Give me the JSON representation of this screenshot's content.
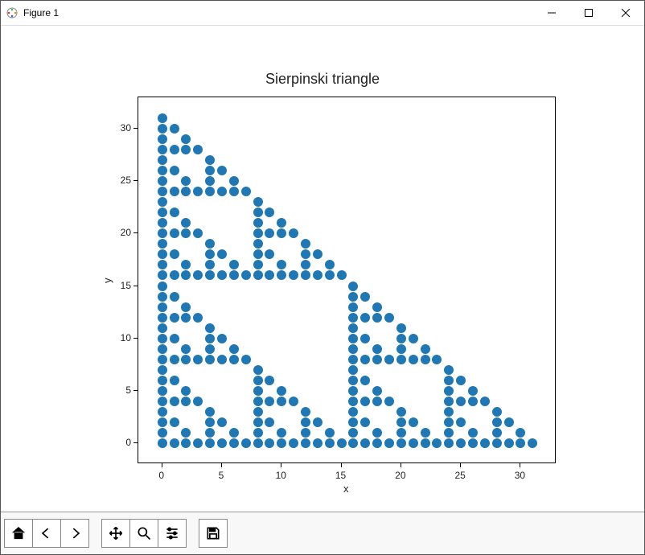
{
  "window": {
    "title": "Figure 1"
  },
  "chart_data": {
    "type": "scatter",
    "title": "Sierpinski triangle",
    "xlabel": "x",
    "ylabel": "y",
    "xlim": [
      -2,
      33
    ],
    "ylim": [
      -2,
      33
    ],
    "xticks": [
      0,
      5,
      10,
      15,
      20,
      25,
      30
    ],
    "yticks": [
      0,
      5,
      10,
      15,
      20,
      25,
      30
    ],
    "description": "points (x,y) for 0<=x<=31,0<=y<=31 where Pascal's triangle entry C(x+y,x) is odd, i.e. (x & y)==0",
    "series": [
      {
        "name": "points",
        "color": "#1f77b4",
        "marker": "o",
        "points": [
          [
            0,
            0
          ],
          [
            1,
            0
          ],
          [
            2,
            0
          ],
          [
            3,
            0
          ],
          [
            4,
            0
          ],
          [
            5,
            0
          ],
          [
            6,
            0
          ],
          [
            7,
            0
          ],
          [
            8,
            0
          ],
          [
            9,
            0
          ],
          [
            10,
            0
          ],
          [
            11,
            0
          ],
          [
            12,
            0
          ],
          [
            13,
            0
          ],
          [
            14,
            0
          ],
          [
            15,
            0
          ],
          [
            16,
            0
          ],
          [
            17,
            0
          ],
          [
            18,
            0
          ],
          [
            19,
            0
          ],
          [
            20,
            0
          ],
          [
            21,
            0
          ],
          [
            22,
            0
          ],
          [
            23,
            0
          ],
          [
            24,
            0
          ],
          [
            25,
            0
          ],
          [
            26,
            0
          ],
          [
            27,
            0
          ],
          [
            28,
            0
          ],
          [
            29,
            0
          ],
          [
            30,
            0
          ],
          [
            31,
            0
          ],
          [
            0,
            1
          ],
          [
            2,
            1
          ],
          [
            4,
            1
          ],
          [
            6,
            1
          ],
          [
            8,
            1
          ],
          [
            10,
            1
          ],
          [
            12,
            1
          ],
          [
            14,
            1
          ],
          [
            16,
            1
          ],
          [
            18,
            1
          ],
          [
            20,
            1
          ],
          [
            22,
            1
          ],
          [
            24,
            1
          ],
          [
            26,
            1
          ],
          [
            28,
            1
          ],
          [
            30,
            1
          ],
          [
            0,
            2
          ],
          [
            1,
            2
          ],
          [
            4,
            2
          ],
          [
            5,
            2
          ],
          [
            8,
            2
          ],
          [
            9,
            2
          ],
          [
            12,
            2
          ],
          [
            13,
            2
          ],
          [
            16,
            2
          ],
          [
            17,
            2
          ],
          [
            20,
            2
          ],
          [
            21,
            2
          ],
          [
            24,
            2
          ],
          [
            25,
            2
          ],
          [
            28,
            2
          ],
          [
            29,
            2
          ],
          [
            0,
            3
          ],
          [
            4,
            3
          ],
          [
            8,
            3
          ],
          [
            12,
            3
          ],
          [
            16,
            3
          ],
          [
            20,
            3
          ],
          [
            24,
            3
          ],
          [
            28,
            3
          ],
          [
            0,
            4
          ],
          [
            1,
            4
          ],
          [
            2,
            4
          ],
          [
            3,
            4
          ],
          [
            8,
            4
          ],
          [
            9,
            4
          ],
          [
            10,
            4
          ],
          [
            11,
            4
          ],
          [
            16,
            4
          ],
          [
            17,
            4
          ],
          [
            18,
            4
          ],
          [
            19,
            4
          ],
          [
            24,
            4
          ],
          [
            25,
            4
          ],
          [
            26,
            4
          ],
          [
            27,
            4
          ],
          [
            0,
            5
          ],
          [
            2,
            5
          ],
          [
            8,
            5
          ],
          [
            10,
            5
          ],
          [
            16,
            5
          ],
          [
            18,
            5
          ],
          [
            24,
            5
          ],
          [
            26,
            5
          ],
          [
            0,
            6
          ],
          [
            1,
            6
          ],
          [
            8,
            6
          ],
          [
            9,
            6
          ],
          [
            16,
            6
          ],
          [
            17,
            6
          ],
          [
            24,
            6
          ],
          [
            25,
            6
          ],
          [
            0,
            7
          ],
          [
            8,
            7
          ],
          [
            16,
            7
          ],
          [
            24,
            7
          ],
          [
            0,
            8
          ],
          [
            1,
            8
          ],
          [
            2,
            8
          ],
          [
            3,
            8
          ],
          [
            4,
            8
          ],
          [
            5,
            8
          ],
          [
            6,
            8
          ],
          [
            7,
            8
          ],
          [
            16,
            8
          ],
          [
            17,
            8
          ],
          [
            18,
            8
          ],
          [
            19,
            8
          ],
          [
            20,
            8
          ],
          [
            21,
            8
          ],
          [
            22,
            8
          ],
          [
            23,
            8
          ],
          [
            0,
            9
          ],
          [
            2,
            9
          ],
          [
            4,
            9
          ],
          [
            6,
            9
          ],
          [
            16,
            9
          ],
          [
            18,
            9
          ],
          [
            20,
            9
          ],
          [
            22,
            9
          ],
          [
            0,
            10
          ],
          [
            1,
            10
          ],
          [
            4,
            10
          ],
          [
            5,
            10
          ],
          [
            16,
            10
          ],
          [
            17,
            10
          ],
          [
            20,
            10
          ],
          [
            21,
            10
          ],
          [
            0,
            11
          ],
          [
            4,
            11
          ],
          [
            16,
            11
          ],
          [
            20,
            11
          ],
          [
            0,
            12
          ],
          [
            1,
            12
          ],
          [
            2,
            12
          ],
          [
            3,
            12
          ],
          [
            16,
            12
          ],
          [
            17,
            12
          ],
          [
            18,
            12
          ],
          [
            19,
            12
          ],
          [
            0,
            13
          ],
          [
            2,
            13
          ],
          [
            16,
            13
          ],
          [
            18,
            13
          ],
          [
            0,
            14
          ],
          [
            1,
            14
          ],
          [
            16,
            14
          ],
          [
            17,
            14
          ],
          [
            0,
            15
          ],
          [
            16,
            15
          ],
          [
            0,
            16
          ],
          [
            1,
            16
          ],
          [
            2,
            16
          ],
          [
            3,
            16
          ],
          [
            4,
            16
          ],
          [
            5,
            16
          ],
          [
            6,
            16
          ],
          [
            7,
            16
          ],
          [
            8,
            16
          ],
          [
            9,
            16
          ],
          [
            10,
            16
          ],
          [
            11,
            16
          ],
          [
            12,
            16
          ],
          [
            13,
            16
          ],
          [
            14,
            16
          ],
          [
            15,
            16
          ],
          [
            0,
            17
          ],
          [
            2,
            17
          ],
          [
            4,
            17
          ],
          [
            6,
            17
          ],
          [
            8,
            17
          ],
          [
            10,
            17
          ],
          [
            12,
            17
          ],
          [
            14,
            17
          ],
          [
            0,
            18
          ],
          [
            1,
            18
          ],
          [
            4,
            18
          ],
          [
            5,
            18
          ],
          [
            8,
            18
          ],
          [
            9,
            18
          ],
          [
            12,
            18
          ],
          [
            13,
            18
          ],
          [
            0,
            19
          ],
          [
            4,
            19
          ],
          [
            8,
            19
          ],
          [
            12,
            19
          ],
          [
            0,
            20
          ],
          [
            1,
            20
          ],
          [
            2,
            20
          ],
          [
            3,
            20
          ],
          [
            8,
            20
          ],
          [
            9,
            20
          ],
          [
            10,
            20
          ],
          [
            11,
            20
          ],
          [
            0,
            21
          ],
          [
            2,
            21
          ],
          [
            8,
            21
          ],
          [
            10,
            21
          ],
          [
            0,
            22
          ],
          [
            1,
            22
          ],
          [
            8,
            22
          ],
          [
            9,
            22
          ],
          [
            0,
            23
          ],
          [
            8,
            23
          ],
          [
            0,
            24
          ],
          [
            1,
            24
          ],
          [
            2,
            24
          ],
          [
            3,
            24
          ],
          [
            4,
            24
          ],
          [
            5,
            24
          ],
          [
            6,
            24
          ],
          [
            7,
            24
          ],
          [
            0,
            25
          ],
          [
            2,
            25
          ],
          [
            4,
            25
          ],
          [
            6,
            25
          ],
          [
            0,
            26
          ],
          [
            1,
            26
          ],
          [
            4,
            26
          ],
          [
            5,
            26
          ],
          [
            0,
            27
          ],
          [
            4,
            27
          ],
          [
            0,
            28
          ],
          [
            1,
            28
          ],
          [
            2,
            28
          ],
          [
            3,
            28
          ],
          [
            0,
            29
          ],
          [
            2,
            29
          ],
          [
            0,
            30
          ],
          [
            1,
            30
          ],
          [
            0,
            31
          ]
        ]
      }
    ]
  },
  "toolbar": {
    "buttons": [
      "home",
      "back",
      "forward",
      "pan",
      "zoom",
      "configure",
      "save"
    ]
  }
}
